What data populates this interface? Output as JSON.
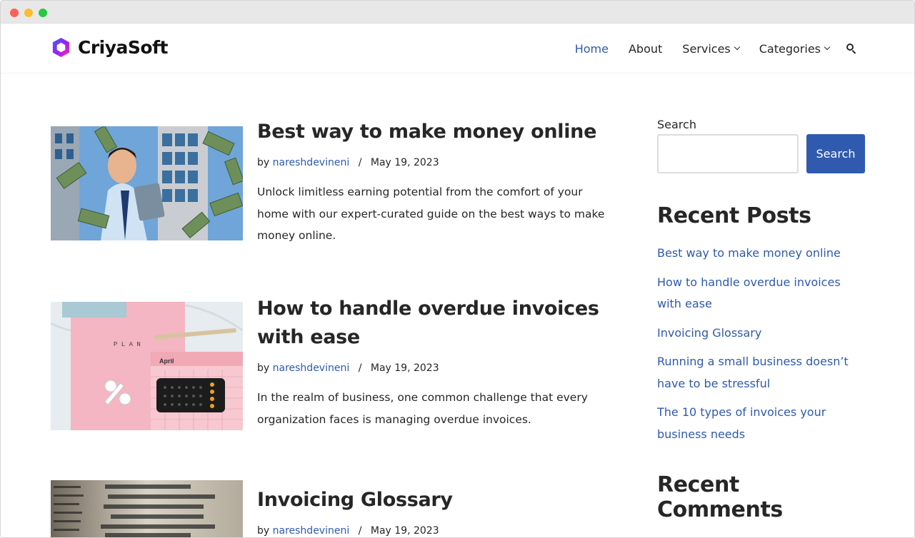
{
  "site": {
    "logo_text": "CriyaSoft"
  },
  "nav": {
    "items": [
      {
        "label": "Home",
        "active": true
      },
      {
        "label": "About"
      },
      {
        "label": "Services"
      },
      {
        "label": "Categories"
      }
    ]
  },
  "posts": [
    {
      "title": "Best way to make money online",
      "author": "nareshdevineni",
      "separator": "/",
      "date": "May 19, 2023",
      "by_label": "by",
      "excerpt": "Unlock limitless earning potential from the comfort of your home with our expert-curated guide on the best ways to make money online."
    },
    {
      "title": "How to handle overdue invoices with ease",
      "author": "nareshdevineni",
      "separator": "/",
      "date": "May 19, 2023",
      "by_label": "by",
      "excerpt": "In the realm of business, one common challenge that every organization faces is managing overdue invoices."
    },
    {
      "title": "Invoicing Glossary",
      "author": "nareshdevineni",
      "separator": "/",
      "date": "May 19, 2023",
      "by_label": "by",
      "excerpt": ""
    }
  ],
  "thumb2": {
    "calendar_month": "April",
    "plan_letters": "P L A N"
  },
  "sidebar": {
    "search_label": "Search",
    "search_button": "Search",
    "recent_posts_heading": "Recent Posts",
    "recent_posts": [
      "Best way to make money online",
      "How to handle overdue invoices with ease",
      "Invoicing Glossary",
      "Running a small business doesn’t have to be stressful",
      "The 10 types of invoices your business needs"
    ],
    "recent_comments_heading": "Recent Comments"
  },
  "colors": {
    "accent": "#2f5aae",
    "text": "#272626"
  }
}
